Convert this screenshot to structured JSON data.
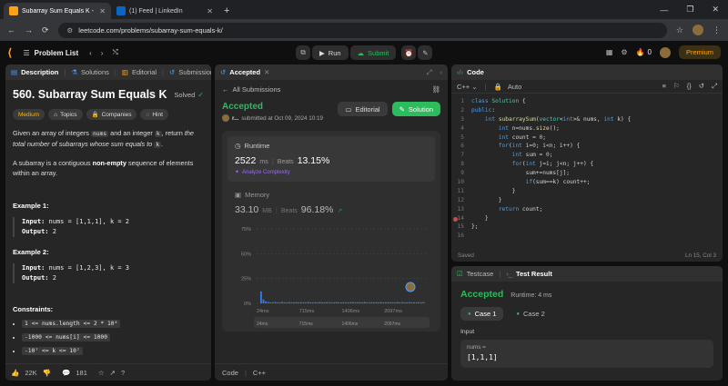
{
  "browser": {
    "tabs": [
      {
        "title": "Subarray Sum Equals K - LeetC",
        "active": true
      },
      {
        "title": "(1) Feed | LinkedIn",
        "active": false
      }
    ],
    "url": "leetcode.com/problems/subarray-sum-equals-k/"
  },
  "nav": {
    "problem_list": "Problem List",
    "run": "Run",
    "submit": "Submit",
    "streak": "0",
    "premium": "Premium"
  },
  "description": {
    "tabs": [
      "Description",
      "Solutions",
      "Editorial",
      "Submissions"
    ],
    "title": "560. Subarray Sum Equals K",
    "solved": "Solved",
    "difficulty": "Medium",
    "chips": [
      "Topics",
      "Companies",
      "Hint"
    ],
    "para1_a": "Given an array of integers ",
    "para1_nums": "nums",
    "para1_b": " and an integer ",
    "para1_k": "k",
    "para1_c": ", return ",
    "para1_d": "the total number of subarrays whose sum equals to ",
    "para1_k2": "k",
    "para1_e": ".",
    "para2_a": "A subarray is a contiguous ",
    "para2_b": "non-empty",
    "para2_c": " sequence of elements within an array.",
    "ex1_title": "Example 1:",
    "ex1_input_label": "Input:",
    "ex1_input": "nums = [1,1,1], k = 2",
    "ex1_output_label": "Output:",
    "ex1_output": "2",
    "ex2_title": "Example 2:",
    "ex2_input_label": "Input:",
    "ex2_input": "nums = [1,2,3], k = 3",
    "ex2_output_label": "Output:",
    "ex2_output": "2",
    "constraints_title": "Constraints:",
    "constraints": [
      "1 <= nums.length <= 2 * 10⁴",
      "-1000 <= nums[i] <= 1000",
      "-10⁷ <= k <= 10⁷"
    ],
    "likes": "22K",
    "comments": "181"
  },
  "accepted": {
    "tab": "Accepted",
    "back": "All Submissions",
    "status": "Accepted",
    "user": "r...",
    "submitted": "submitted at Oct 09, 2024 10:19",
    "editorial_btn": "Editorial",
    "solution_btn": "Solution",
    "runtime_label": "Runtime",
    "runtime_value": "2522",
    "runtime_unit": "ms",
    "beats_label": "Beats",
    "runtime_beats": "13.15%",
    "analyze": "Analyze Complexity",
    "memory_label": "Memory",
    "memory_value": "33.10",
    "memory_unit": "MB",
    "memory_beats": "96.18%",
    "footer_code": "Code",
    "footer_lang": "C++"
  },
  "chart_data": {
    "type": "bar",
    "y_ticks": [
      "75%",
      "50%",
      "25%",
      "0%"
    ],
    "x_ticks": [
      "24ms",
      "715ms",
      "1406ms",
      "2097ms"
    ],
    "ylim": [
      0,
      75
    ],
    "values": [
      12,
      4,
      2,
      1.5,
      1,
      1,
      1.5,
      1,
      1,
      1.5,
      1,
      1,
      1.2,
      1,
      1,
      1.3,
      1,
      1.2,
      1,
      1,
      1.4,
      1,
      1,
      1.2,
      1,
      1.3,
      1,
      1,
      1.2,
      1,
      1.1,
      1,
      1.3,
      1,
      1,
      1.2,
      1,
      1,
      1.1,
      1.3,
      1,
      1,
      1.2,
      1,
      1.4,
      1,
      1,
      1.2,
      1,
      1.1,
      1,
      1.3,
      1,
      1,
      1.2,
      1,
      1.1,
      1,
      1.3,
      1,
      1.2,
      1,
      1,
      1.3,
      1,
      1.1,
      1,
      1.2,
      1,
      1.3
    ],
    "accent": "#2f80ed"
  },
  "code": {
    "tab": "Code",
    "lang": "C++",
    "auto": "Auto",
    "saved": "Saved",
    "position": "Ln 15, Col 3"
  },
  "testcase": {
    "tab1": "Testcase",
    "tab2": "Test Result",
    "status": "Accepted",
    "runtime": "Runtime: 4 ms",
    "case1": "Case 1",
    "case2": "Case 2",
    "input_label": "Input",
    "var_label": "nums =",
    "var_value": "[1,1,1]"
  }
}
